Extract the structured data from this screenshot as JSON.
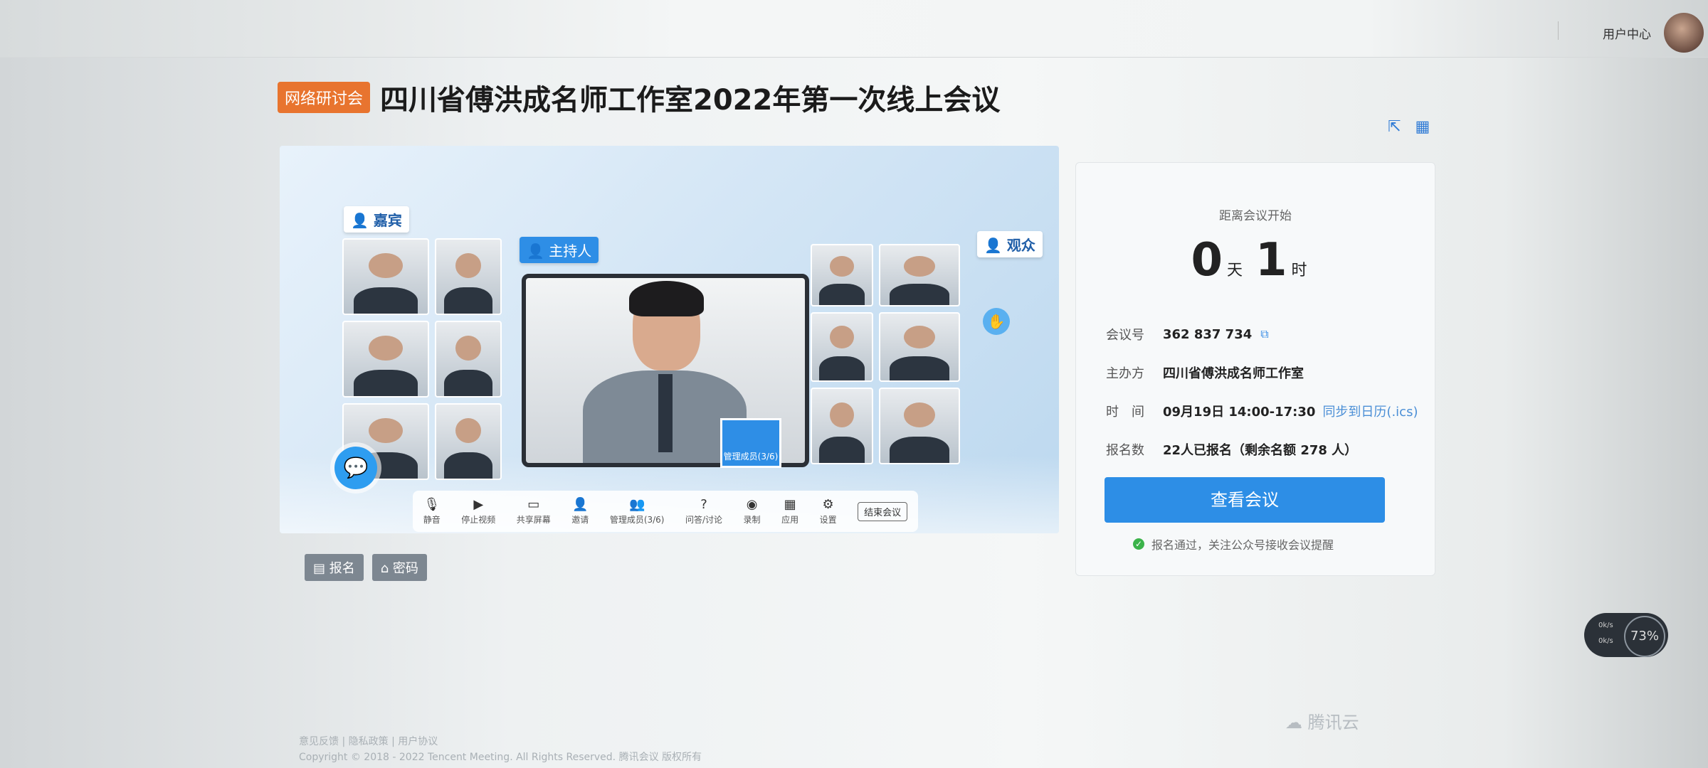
{
  "topbar": {
    "user_center": "用户中心"
  },
  "header": {
    "badge": "网络研讨会",
    "title": "四川省傅洪成名师工作室2022年第一次线上会议"
  },
  "hero": {
    "guest_tag": "嘉宾",
    "host_tag": "主持人",
    "audience_tag": "观众",
    "role_label": "管理成员(3/6)",
    "toolbar": [
      {
        "icon": "mic-icon",
        "label": "静音"
      },
      {
        "icon": "camera-icon",
        "label": "停止视频"
      },
      {
        "icon": "screen-share-icon",
        "label": "共享屏幕"
      },
      {
        "icon": "invite-icon",
        "label": "邀请"
      },
      {
        "icon": "members-icon",
        "label": "管理成员(3/6)"
      },
      {
        "icon": "qa-icon",
        "label": "问答/讨论"
      },
      {
        "icon": "record-icon",
        "label": "录制"
      },
      {
        "icon": "apps-icon",
        "label": "应用"
      },
      {
        "icon": "settings-icon",
        "label": "设置"
      }
    ],
    "end_button": "结束会议"
  },
  "actions": {
    "signup": "报名",
    "password": "密码"
  },
  "panel": {
    "countdown_label": "距离会议开始",
    "days": "0",
    "days_unit": "天",
    "hours": "1",
    "hours_unit": "时",
    "meeting_id_key": "会议号",
    "meeting_id": "362 837 734",
    "host_key": "主办方",
    "host": "四川省傅洪成名师工作室",
    "time_key": "时　间",
    "time": "09月19日 14:00-17:30",
    "calendar_link": "同步到日历(.ics)",
    "registered_key": "报名数",
    "registered": "22人已报名（剩余名额 278 人）",
    "view_button": "查看会议",
    "notice": "报名通过，关注公众号接收会议提醒"
  },
  "speed_widget": {
    "percent": "73%",
    "up": "0k/s",
    "down": "0k/s"
  },
  "brand": {
    "cloud": "腾讯云"
  },
  "footer": {
    "links": "意见反馈 | 隐私政策 | 用户协议",
    "copyright": "Copyright © 2018 - 2022 Tencent Meeting. All Rights Reserved. 腾讯会议 版权所有"
  },
  "colors": {
    "primary": "#2d8ee6",
    "badge": "#e8742f"
  }
}
